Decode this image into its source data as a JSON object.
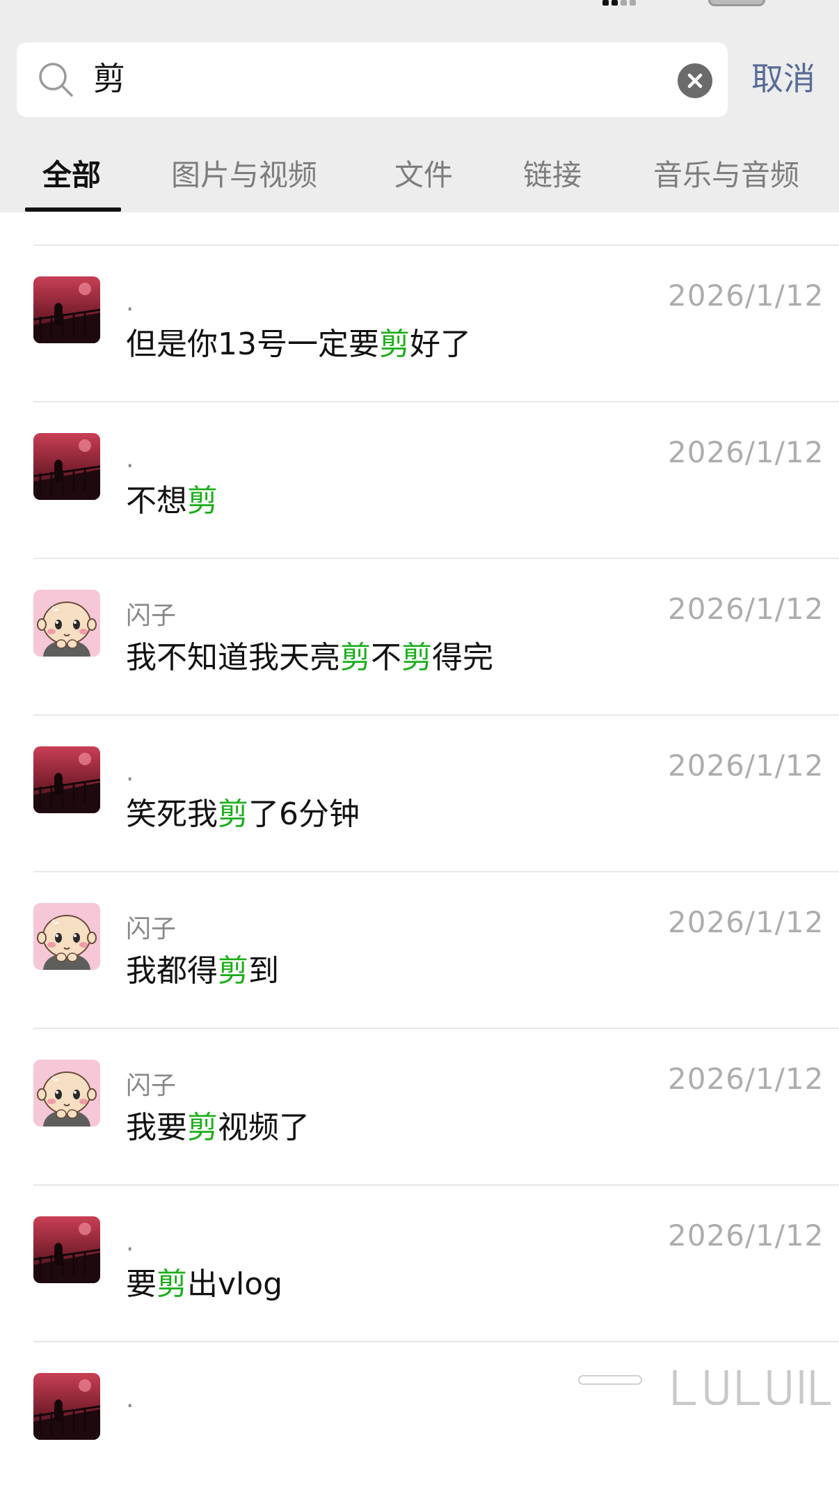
{
  "search": {
    "value": "剪",
    "cancel_label": "取消"
  },
  "tabs": [
    {
      "label": "全部",
      "active": true
    },
    {
      "label": "图片与视频",
      "active": false
    },
    {
      "label": "文件",
      "active": false
    },
    {
      "label": "链接",
      "active": false
    },
    {
      "label": "音乐与音频",
      "active": false
    }
  ],
  "colors": {
    "highlight": "#1aad19",
    "link": "#576b95",
    "header_bg": "#ededed"
  },
  "results": [
    {
      "avatar": "avatar-dusk",
      "sender": ".",
      "date": "2026/1/12",
      "before": "但是你13号一定要",
      "match": "剪",
      "after": "好了",
      "match2": "",
      "after2": ""
    },
    {
      "avatar": "avatar-dusk",
      "sender": ".",
      "date": "2026/1/12",
      "before": "不想",
      "match": "剪",
      "after": "",
      "match2": "",
      "after2": ""
    },
    {
      "avatar": "avatar-cartoon",
      "sender": "闪子",
      "date": "2026/1/12",
      "before": "我不知道我天亮",
      "match": "剪",
      "after": "不",
      "match2": "剪",
      "after2": "得完"
    },
    {
      "avatar": "avatar-dusk",
      "sender": ".",
      "date": "2026/1/12",
      "before": "笑死我",
      "match": "剪",
      "after": "了6分钟",
      "match2": "",
      "after2": ""
    },
    {
      "avatar": "avatar-cartoon",
      "sender": "闪子",
      "date": "2026/1/12",
      "before": "我都得",
      "match": "剪",
      "after": "到",
      "match2": "",
      "after2": ""
    },
    {
      "avatar": "avatar-cartoon",
      "sender": "闪子",
      "date": "2026/1/12",
      "before": "我要",
      "match": "剪",
      "after": "视频了",
      "match2": "",
      "after2": ""
    },
    {
      "avatar": "avatar-dusk",
      "sender": ".",
      "date": "2026/1/12",
      "before": "要",
      "match": "剪",
      "after": "出vlog",
      "match2": "",
      "after2": ""
    },
    {
      "avatar": "avatar-dusk",
      "sender": ".",
      "date": "",
      "before": "",
      "match": "",
      "after": "",
      "match2": "",
      "after2": ""
    }
  ]
}
